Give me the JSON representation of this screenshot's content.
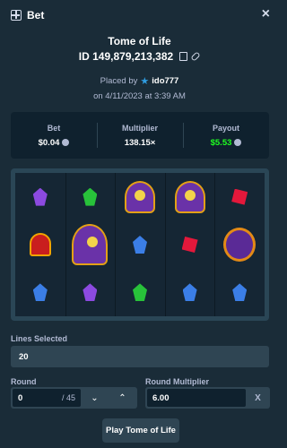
{
  "header": {
    "title": "Bet",
    "icon": "bet-icon",
    "close_icon": "close-icon"
  },
  "bet": {
    "game_name": "Tome of Life",
    "id": "ID 149,879,213,382",
    "placed_by_label": "Placed by",
    "user": "ido777",
    "placed_on": "on 4/11/2023 at 3:39 AM"
  },
  "stats": {
    "bet_label": "Bet",
    "bet_value": "$0.04",
    "multiplier_label": "Multiplier",
    "multiplier_value": "138.15×",
    "payout_label": "Payout",
    "payout_value": "$5.53",
    "payout_color": "#1fff20"
  },
  "board": {
    "columns": 5,
    "rows": [
      [
        "purple-gem",
        "green-gem",
        "pharaoh",
        "pharaoh",
        "red-gem"
      ],
      [
        "red-ghost",
        "pharaoh-large",
        "blue-gem",
        "red-gem",
        "tome-book"
      ],
      [
        "blue-gem",
        "purple-gem",
        "green-gem",
        "blue-gem",
        "blue-gem"
      ]
    ]
  },
  "form": {
    "lines_label": "Lines Selected",
    "lines_value": "20",
    "round_label": "Round",
    "round_value": "0",
    "round_total": "/ 45",
    "round_multiplier_label": "Round Multiplier",
    "round_multiplier_value": "6.00",
    "clear_label": "X"
  },
  "play_button": "Play Tome of Life"
}
